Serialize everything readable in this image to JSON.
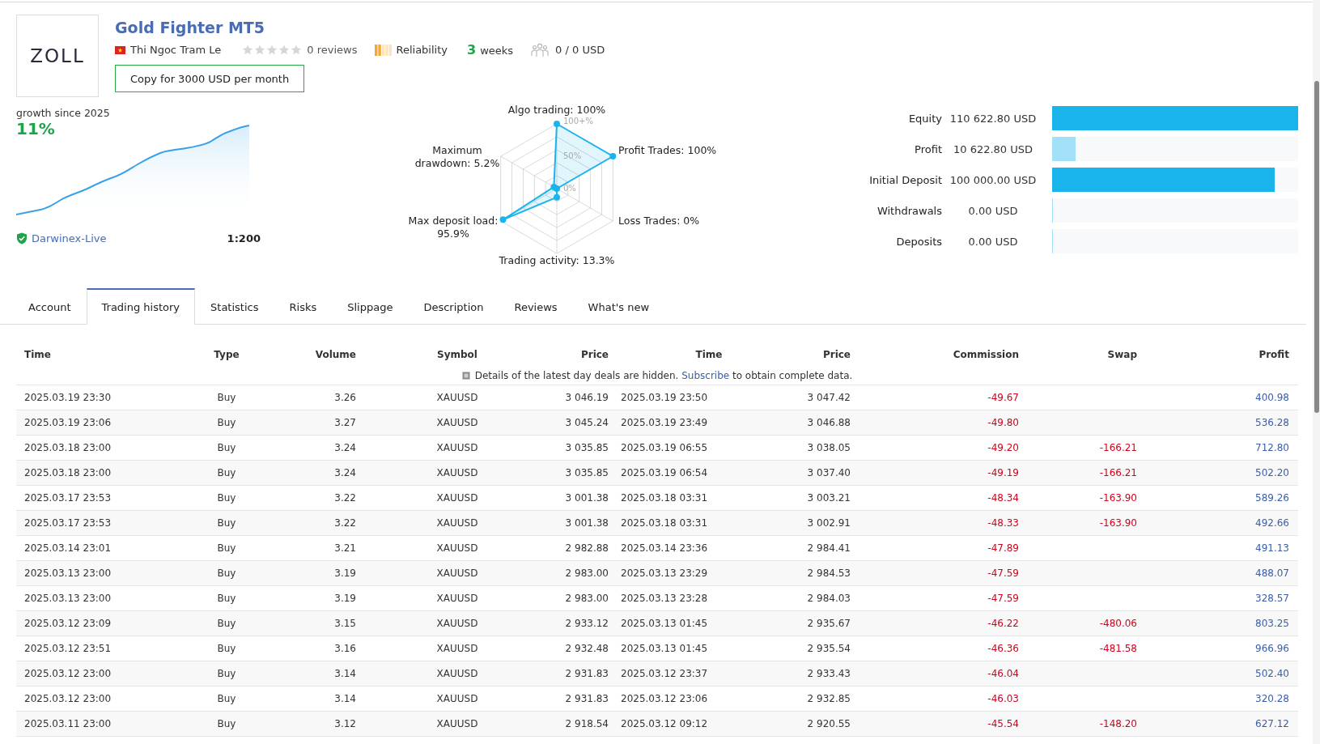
{
  "signal": {
    "logo": "ZOLL",
    "title": "Gold Fighter MT5",
    "author": "Thi Ngoc Tram Le",
    "stars": 0,
    "reviews": "0 reviews",
    "reliability": {
      "label": "Reliability",
      "level": 0.4
    },
    "age_number": "3",
    "age_unit": "weeks",
    "subscribers": "0 / 0 USD",
    "copy_button": "Copy for 3000 USD per month"
  },
  "growth": {
    "caption": "growth since 2025",
    "value": "11%",
    "server": "Darwinex-Live",
    "leverage": "1:200"
  },
  "radar": {
    "axes": [
      {
        "lines": [
          "Algo trading: 100%"
        ]
      },
      {
        "lines": [
          "Maximum",
          "drawdown: 5.2%"
        ]
      },
      {
        "lines": [
          "Profit Trades: 100%"
        ]
      },
      {
        "lines": [
          "Max deposit load:",
          "95.9%"
        ]
      },
      {
        "lines": [
          "Loss Trades: 0%"
        ]
      },
      {
        "lines": [
          "Trading activity: 13.3%"
        ]
      }
    ],
    "scale_labels": [
      "100+%",
      "50%",
      "0%"
    ]
  },
  "balance": [
    {
      "label": "Equity",
      "value": "110 622.80 USD",
      "level": 1.0,
      "color": "#1ab4ec"
    },
    {
      "label": "Profit",
      "value": "10 622.80 USD",
      "level": 0.096,
      "color": "#a3e1f8"
    },
    {
      "label": "Initial Deposit",
      "value": "100 000.00 USD",
      "level": 0.904,
      "color": "#1ab4ec"
    },
    {
      "label": "Withdrawals",
      "value": "0.00 USD",
      "level": 0.0
    },
    {
      "label": "Deposits",
      "value": "0.00 USD",
      "level": 0.0
    }
  ],
  "tabs": [
    {
      "label": "Account",
      "selected": false
    },
    {
      "label": "Trading history",
      "selected": true
    },
    {
      "label": "Statistics",
      "selected": false
    },
    {
      "label": "Risks",
      "selected": false
    },
    {
      "label": "Slippage",
      "selected": false
    },
    {
      "label": "Description",
      "selected": false
    },
    {
      "label": "Reviews",
      "selected": false
    },
    {
      "label": "What's new",
      "selected": false
    }
  ],
  "table": {
    "columns": [
      "Time",
      "Type",
      "Volume",
      "Symbol",
      "Price",
      "Time",
      "Price",
      "Commission",
      "Swap",
      "Profit"
    ],
    "notice": {
      "before": "Details of the latest day deals are hidden.",
      "link": "Subscribe",
      "after": "to obtain complete data."
    },
    "rows": [
      [
        "2025.03.19 23:30",
        "Buy",
        "3.26",
        "XAUUSD",
        "3 046.19",
        "2025.03.19 23:50",
        "3 047.42",
        "-49.67",
        "",
        "400.98"
      ],
      [
        "2025.03.19 23:06",
        "Buy",
        "3.27",
        "XAUUSD",
        "3 045.24",
        "2025.03.19 23:49",
        "3 046.88",
        "-49.80",
        "",
        "536.28"
      ],
      [
        "2025.03.18 23:00",
        "Buy",
        "3.24",
        "XAUUSD",
        "3 035.85",
        "2025.03.19 06:55",
        "3 038.05",
        "-49.20",
        "-166.21",
        "712.80"
      ],
      [
        "2025.03.18 23:00",
        "Buy",
        "3.24",
        "XAUUSD",
        "3 035.85",
        "2025.03.19 06:54",
        "3 037.40",
        "-49.19",
        "-166.21",
        "502.20"
      ],
      [
        "2025.03.17 23:53",
        "Buy",
        "3.22",
        "XAUUSD",
        "3 001.38",
        "2025.03.18 03:31",
        "3 003.21",
        "-48.34",
        "-163.90",
        "589.26"
      ],
      [
        "2025.03.17 23:53",
        "Buy",
        "3.22",
        "XAUUSD",
        "3 001.38",
        "2025.03.18 03:31",
        "3 002.91",
        "-48.33",
        "-163.90",
        "492.66"
      ],
      [
        "2025.03.14 23:01",
        "Buy",
        "3.21",
        "XAUUSD",
        "2 982.88",
        "2025.03.14 23:36",
        "2 984.41",
        "-47.89",
        "",
        "491.13"
      ],
      [
        "2025.03.13 23:00",
        "Buy",
        "3.19",
        "XAUUSD",
        "2 983.00",
        "2025.03.13 23:29",
        "2 984.53",
        "-47.59",
        "",
        "488.07"
      ],
      [
        "2025.03.13 23:00",
        "Buy",
        "3.19",
        "XAUUSD",
        "2 983.00",
        "2025.03.13 23:28",
        "2 984.03",
        "-47.59",
        "",
        "328.57"
      ],
      [
        "2025.03.12 23:09",
        "Buy",
        "3.15",
        "XAUUSD",
        "2 933.12",
        "2025.03.13 01:45",
        "2 935.67",
        "-46.22",
        "-480.06",
        "803.25"
      ],
      [
        "2025.03.12 23:51",
        "Buy",
        "3.16",
        "XAUUSD",
        "2 932.48",
        "2025.03.13 01:45",
        "2 935.54",
        "-46.36",
        "-481.58",
        "966.96"
      ],
      [
        "2025.03.12 23:00",
        "Buy",
        "3.14",
        "XAUUSD",
        "2 931.83",
        "2025.03.12 23:37",
        "2 933.43",
        "-46.04",
        "",
        "502.40"
      ],
      [
        "2025.03.12 23:00",
        "Buy",
        "3.14",
        "XAUUSD",
        "2 931.83",
        "2025.03.12 23:06",
        "2 932.85",
        "-46.03",
        "",
        "320.28"
      ],
      [
        "2025.03.11 23:00",
        "Buy",
        "3.12",
        "XAUUSD",
        "2 918.54",
        "2025.03.12 09:12",
        "2 920.55",
        "-45.54",
        "-148.20",
        "627.12"
      ]
    ]
  }
}
